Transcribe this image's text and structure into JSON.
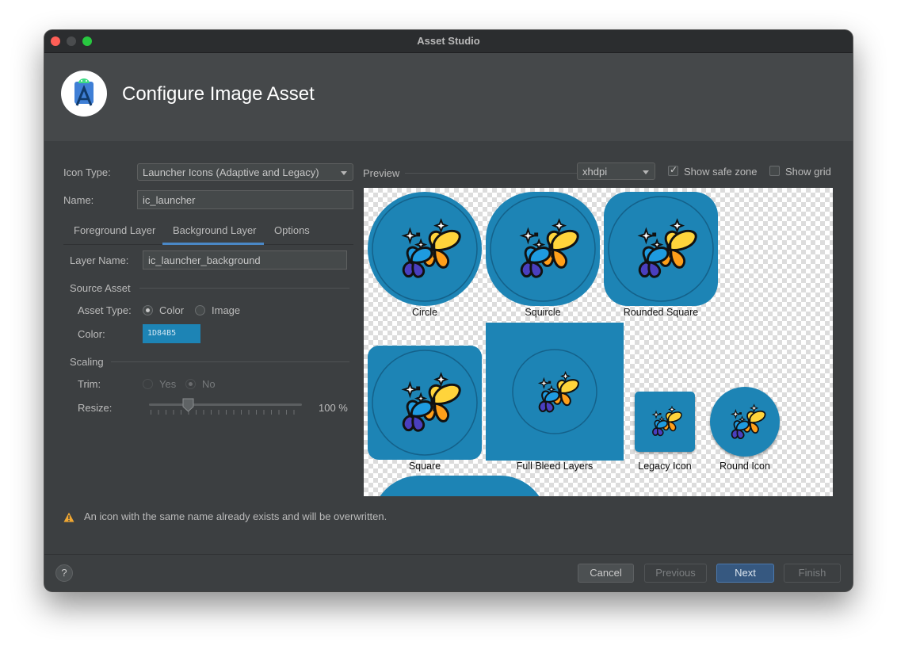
{
  "window": {
    "title": "Asset Studio"
  },
  "header": {
    "title": "Configure Image Asset",
    "logo_icon": "android-studio-icon"
  },
  "form": {
    "icon_type_label": "Icon Type:",
    "icon_type_value": "Launcher Icons (Adaptive and Legacy)",
    "name_label": "Name:",
    "name_value": "ic_launcher"
  },
  "tabs": [
    {
      "label": "Foreground Layer",
      "selected": false
    },
    {
      "label": "Background Layer",
      "selected": true
    },
    {
      "label": "Options",
      "selected": false
    }
  ],
  "layer": {
    "layer_name_label": "Layer Name:",
    "layer_name_value": "ic_launcher_background",
    "source_asset_title": "Source Asset",
    "asset_type_label": "Asset Type:",
    "asset_type_options": [
      {
        "label": "Color",
        "selected": true
      },
      {
        "label": "Image",
        "selected": false
      }
    ],
    "color_label": "Color:",
    "color_value": "1D84B5",
    "color_hex": "#1D84B5",
    "scaling_title": "Scaling",
    "trim_label": "Trim:",
    "trim_options": [
      {
        "label": "Yes",
        "selected": false
      },
      {
        "label": "No",
        "selected": true
      }
    ],
    "resize_label": "Resize:",
    "resize_value": "100 %",
    "resize_fraction": 0.25
  },
  "preview": {
    "title": "Preview",
    "density": "xhdpi",
    "show_safe_zone_label": "Show safe zone",
    "show_safe_zone": true,
    "show_grid_label": "Show grid",
    "show_grid": false,
    "captions": {
      "circle": "Circle",
      "squircle": "Squircle",
      "rounded_square": "Rounded Square",
      "square": "Square",
      "full_bleed": "Full Bleed Layers",
      "legacy": "Legacy Icon",
      "round": "Round Icon"
    }
  },
  "warning": {
    "text": "An icon with the same name already exists and will be overwritten.",
    "icon": "warning-icon"
  },
  "footer": {
    "help_label": "?",
    "cancel": "Cancel",
    "previous": "Previous",
    "next": "Next",
    "finish": "Finish"
  }
}
